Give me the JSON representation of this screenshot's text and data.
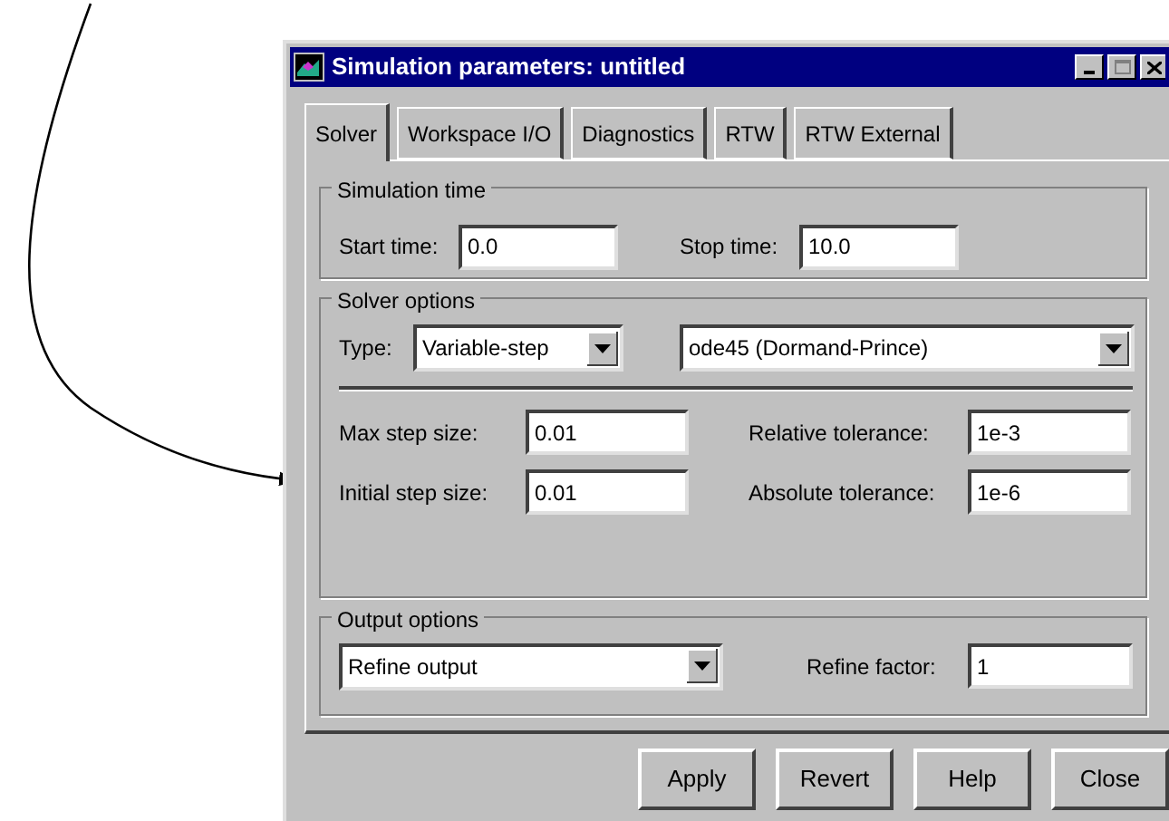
{
  "window": {
    "title": "Simulation parameters: untitled"
  },
  "tabs": [
    {
      "label": "Solver",
      "selected": true
    },
    {
      "label": "Workspace I/O",
      "selected": false
    },
    {
      "label": "Diagnostics",
      "selected": false
    },
    {
      "label": "RTW",
      "selected": false
    },
    {
      "label": "RTW External",
      "selected": false
    }
  ],
  "simulation_time": {
    "title": "Simulation time",
    "start_time": {
      "label": "Start time:",
      "value": "0.0"
    },
    "stop_time": {
      "label": "Stop time:",
      "value": "10.0"
    }
  },
  "solver_options": {
    "title": "Solver options",
    "type": {
      "label": "Type:",
      "value": "Variable-step"
    },
    "solver": {
      "value": "ode45 (Dormand-Prince)"
    },
    "fields": [
      {
        "label": "Max step size:",
        "value": "0.01"
      },
      {
        "label": "Relative tolerance:",
        "value": "1e-3"
      },
      {
        "label": "Initial step size:",
        "value": "0.01"
      },
      {
        "label": "Absolute tolerance:",
        "value": "1e-6"
      }
    ]
  },
  "output_options": {
    "title": "Output options",
    "mode": {
      "value": "Refine output"
    },
    "refine_factor": {
      "label": "Refine factor:",
      "value": "1"
    }
  },
  "buttons": [
    "Apply",
    "Revert",
    "Help",
    "Close"
  ]
}
